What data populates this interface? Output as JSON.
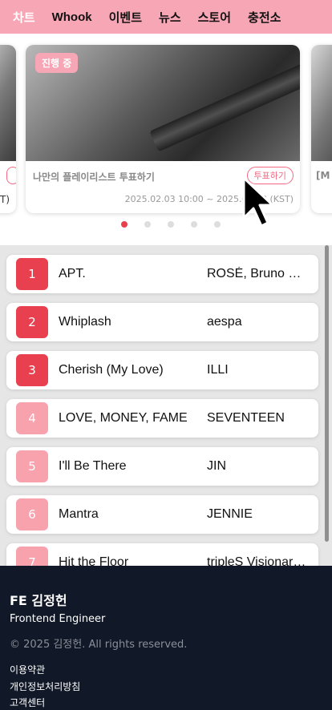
{
  "nav": {
    "items": [
      "차트",
      "Whook",
      "이벤트",
      "뉴스",
      "스토어",
      "충전소"
    ]
  },
  "carousel": {
    "current": {
      "badge": "진행 중",
      "title": "나만의 플레이리스트 투표하기",
      "button": "투표하기",
      "date": "2025.02.03 10:00 ~ 2025.02.28 (KST)"
    },
    "left_partial": {
      "date_suffix": "T)"
    },
    "right_partial": {
      "title_prefix": "[M"
    },
    "dots_total": 5,
    "dots_active_index": 0,
    "colors": {
      "badge": "#f7a6b5",
      "button": "#f26a82",
      "dot_active": "#e8404f"
    }
  },
  "chart": {
    "rows": [
      {
        "rank": "1",
        "title": "APT.",
        "artist": "ROSÉ, Bruno Mars",
        "highlight": true
      },
      {
        "rank": "2",
        "title": "Whiplash",
        "artist": "aespa",
        "highlight": true
      },
      {
        "rank": "3",
        "title": "Cherish (My Love)",
        "artist": "ILLI",
        "highlight": true
      },
      {
        "rank": "4",
        "title": "LOVE, MONEY, FAME",
        "artist": "SEVENTEEN",
        "highlight": false
      },
      {
        "rank": "5",
        "title": "I'll Be There",
        "artist": "JIN",
        "highlight": false
      },
      {
        "rank": "6",
        "title": "Mantra",
        "artist": "JENNIE",
        "highlight": false
      },
      {
        "rank": "7",
        "title": "Hit the Floor",
        "artist": "tripleS Visionary Vision",
        "highlight": false
      }
    ]
  },
  "footer": {
    "name": "FE 김정헌",
    "role": "Frontend Engineer",
    "copyright": "© 2025 김정헌. All rights reserved.",
    "links": [
      "이용약관",
      "개인정보처리방침",
      "고객센터"
    ]
  }
}
